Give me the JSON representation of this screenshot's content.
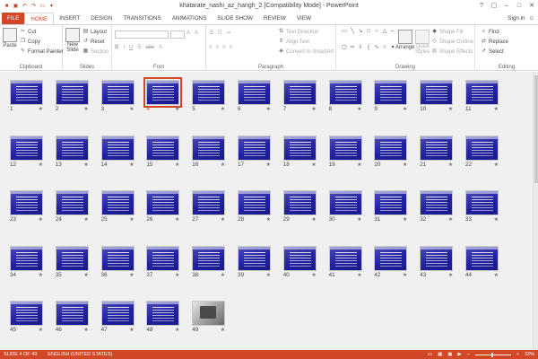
{
  "window": {
    "title": "khatarate_nashi_az_harigh_2 [Compatibility Mode] - PowerPoint",
    "sign_in": "Sign in"
  },
  "tabs": [
    {
      "label": "FILE"
    },
    {
      "label": "HOME"
    },
    {
      "label": "INSERT"
    },
    {
      "label": "DESIGN"
    },
    {
      "label": "TRANSITIONS"
    },
    {
      "label": "ANIMATIONS"
    },
    {
      "label": "SLIDE SHOW"
    },
    {
      "label": "REVIEW"
    },
    {
      "label": "VIEW"
    }
  ],
  "ribbon": {
    "clipboard": {
      "label": "Clipboard",
      "paste": "Paste",
      "cut": "Cut",
      "copy": "Copy",
      "format_painter": "Format Painter"
    },
    "slides": {
      "label": "Slides",
      "new_slide_1": "New",
      "new_slide_2": "Slide",
      "layout": "Layout",
      "reset": "Reset",
      "section": "Section"
    },
    "font": {
      "label": "Font",
      "size_up": "A",
      "size_down": "A"
    },
    "paragraph": {
      "label": "Paragraph",
      "text_direction": "Text Direction",
      "align_text": "Align Text",
      "convert_smartart": "Convert to SmartArt"
    },
    "drawing": {
      "label": "Drawing",
      "arrange": "Arrange",
      "quick_styles_1": "Quick",
      "quick_styles_2": "Styles",
      "shape_fill": "Shape Fill",
      "shape_outline": "Shape Outline",
      "shape_effects": "Shape Effects"
    },
    "editing": {
      "label": "Editing",
      "find": "Find",
      "replace": "Replace",
      "select": "Select"
    }
  },
  "slides": {
    "selected": 4,
    "total": 49,
    "photo_slide": 49,
    "numbers": [
      "1",
      "2",
      "3",
      "4",
      "5",
      "6",
      "7",
      "8",
      "9",
      "10",
      "11",
      "12",
      "13",
      "14",
      "15",
      "16",
      "17",
      "18",
      "19",
      "20",
      "21",
      "22",
      "23",
      "24",
      "25",
      "26",
      "27",
      "28",
      "29",
      "30",
      "31",
      "32",
      "33",
      "34",
      "35",
      "36",
      "37",
      "38",
      "39",
      "40",
      "41",
      "42",
      "43",
      "44",
      "45",
      "46",
      "47",
      "48",
      "49"
    ],
    "star_glyph": "★"
  },
  "status": {
    "slide_info": "SLIDE 4 OF 49",
    "language": "ENGLISH (UNITED STATES)",
    "zoom": "33%"
  },
  "colors": {
    "accent": "#d24726",
    "slide_bg": "#2222a0"
  }
}
